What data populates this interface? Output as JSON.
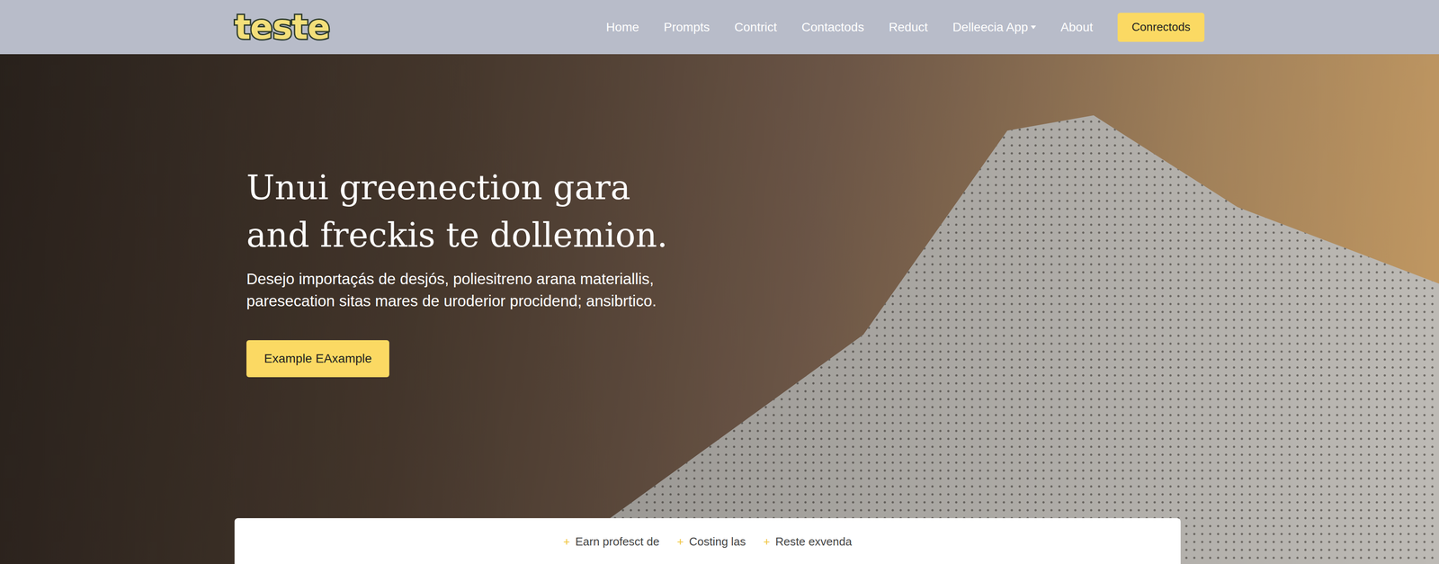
{
  "navbar": {
    "logo": "teste",
    "links": [
      {
        "label": "Home",
        "dropdown": false
      },
      {
        "label": "Prompts",
        "dropdown": false
      },
      {
        "label": "Contrict",
        "dropdown": false
      },
      {
        "label": "Contactods",
        "dropdown": false
      },
      {
        "label": "Reduct",
        "dropdown": false
      },
      {
        "label": "Delleecia App",
        "dropdown": true
      },
      {
        "label": "About",
        "dropdown": false
      }
    ],
    "cta": "Conrectods"
  },
  "hero": {
    "title_lines": [
      "Unui greenection gara",
      "and freckis te dollemion."
    ],
    "subtitle_lines": [
      "Desejo importaçás de desjós, poliesitreno arana materiallis,",
      "paresecation sitas mares de uroderior procidend; ansibrtico."
    ],
    "button": "Example EAxample"
  },
  "features": [
    {
      "icon": "+",
      "label": "Earn profesct de"
    },
    {
      "icon": "+",
      "label": "Costing las"
    },
    {
      "icon": "+",
      "label": "Reste exvenda"
    }
  ]
}
